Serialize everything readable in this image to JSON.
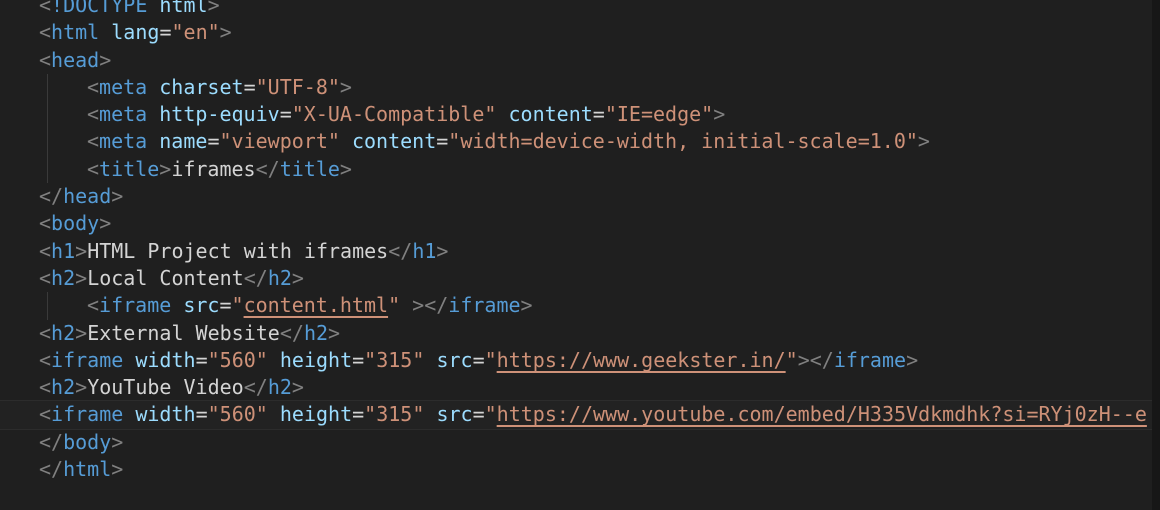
{
  "editor": {
    "lines": [
      {
        "indent": 0,
        "tokens": [
          [
            "br",
            "<"
          ],
          [
            "tg",
            "!DOCTYPE"
          ],
          [
            "tx",
            " "
          ],
          [
            "at",
            "html"
          ],
          [
            "br",
            ">"
          ]
        ]
      },
      {
        "indent": 0,
        "tokens": [
          [
            "br",
            "<"
          ],
          [
            "tg",
            "html"
          ],
          [
            "tx",
            " "
          ],
          [
            "at",
            "lang"
          ],
          [
            "eq",
            "="
          ],
          [
            "st",
            "\"en\""
          ],
          [
            "br",
            ">"
          ]
        ]
      },
      {
        "indent": 0,
        "tokens": [
          [
            "br",
            "<"
          ],
          [
            "tg",
            "head"
          ],
          [
            "br",
            ">"
          ]
        ]
      },
      {
        "indent": 1,
        "tokens": [
          [
            "br",
            "<"
          ],
          [
            "tg",
            "meta"
          ],
          [
            "tx",
            " "
          ],
          [
            "at",
            "charset"
          ],
          [
            "eq",
            "="
          ],
          [
            "st",
            "\"UTF-8\""
          ],
          [
            "br",
            ">"
          ]
        ]
      },
      {
        "indent": 1,
        "tokens": [
          [
            "br",
            "<"
          ],
          [
            "tg",
            "meta"
          ],
          [
            "tx",
            " "
          ],
          [
            "at",
            "http-equiv"
          ],
          [
            "eq",
            "="
          ],
          [
            "st",
            "\"X-UA-Compatible\""
          ],
          [
            "tx",
            " "
          ],
          [
            "at",
            "content"
          ],
          [
            "eq",
            "="
          ],
          [
            "st",
            "\"IE=edge\""
          ],
          [
            "br",
            ">"
          ]
        ]
      },
      {
        "indent": 1,
        "tokens": [
          [
            "br",
            "<"
          ],
          [
            "tg",
            "meta"
          ],
          [
            "tx",
            " "
          ],
          [
            "at",
            "name"
          ],
          [
            "eq",
            "="
          ],
          [
            "st",
            "\"viewport\""
          ],
          [
            "tx",
            " "
          ],
          [
            "at",
            "content"
          ],
          [
            "eq",
            "="
          ],
          [
            "st",
            "\"width=device-width, initial-scale=1.0\""
          ],
          [
            "br",
            ">"
          ]
        ]
      },
      {
        "indent": 1,
        "tokens": [
          [
            "br",
            "<"
          ],
          [
            "tg",
            "title"
          ],
          [
            "br",
            ">"
          ],
          [
            "tx",
            "iframes"
          ],
          [
            "br",
            "</"
          ],
          [
            "tg",
            "title"
          ],
          [
            "br",
            ">"
          ]
        ]
      },
      {
        "indent": 0,
        "tokens": [
          [
            "br",
            "</"
          ],
          [
            "tg",
            "head"
          ],
          [
            "br",
            ">"
          ]
        ]
      },
      {
        "indent": 0,
        "tokens": [
          [
            "br",
            "<"
          ],
          [
            "tg",
            "body"
          ],
          [
            "br",
            ">"
          ]
        ]
      },
      {
        "indent": 0,
        "tokens": [
          [
            "br",
            "<"
          ],
          [
            "tg",
            "h1"
          ],
          [
            "br",
            ">"
          ],
          [
            "tx",
            "HTML Project with iframes"
          ],
          [
            "br",
            "</"
          ],
          [
            "tg",
            "h1"
          ],
          [
            "br",
            ">"
          ]
        ]
      },
      {
        "indent": 0,
        "tokens": [
          [
            "br",
            "<"
          ],
          [
            "tg",
            "h2"
          ],
          [
            "br",
            ">"
          ],
          [
            "tx",
            "Local Content"
          ],
          [
            "br",
            "</"
          ],
          [
            "tg",
            "h2"
          ],
          [
            "br",
            ">"
          ]
        ]
      },
      {
        "indent": 1,
        "tokens": [
          [
            "br",
            "<"
          ],
          [
            "tg",
            "iframe"
          ],
          [
            "tx",
            " "
          ],
          [
            "at",
            "src"
          ],
          [
            "eq",
            "="
          ],
          [
            "st",
            "\""
          ],
          [
            "lk",
            "content.html"
          ],
          [
            "st",
            "\""
          ],
          [
            "tx",
            " "
          ],
          [
            "br",
            "></"
          ],
          [
            "tg",
            "iframe"
          ],
          [
            "br",
            ">"
          ]
        ]
      },
      {
        "indent": 0,
        "tokens": [
          [
            "br",
            "<"
          ],
          [
            "tg",
            "h2"
          ],
          [
            "br",
            ">"
          ],
          [
            "tx",
            "External Website"
          ],
          [
            "br",
            "</"
          ],
          [
            "tg",
            "h2"
          ],
          [
            "br",
            ">"
          ]
        ]
      },
      {
        "indent": 0,
        "tokens": [
          [
            "br",
            "<"
          ],
          [
            "tg",
            "iframe"
          ],
          [
            "tx",
            " "
          ],
          [
            "at",
            "width"
          ],
          [
            "eq",
            "="
          ],
          [
            "st",
            "\"560\""
          ],
          [
            "tx",
            " "
          ],
          [
            "at",
            "height"
          ],
          [
            "eq",
            "="
          ],
          [
            "st",
            "\"315\""
          ],
          [
            "tx",
            " "
          ],
          [
            "at",
            "src"
          ],
          [
            "eq",
            "="
          ],
          [
            "st",
            "\""
          ],
          [
            "lk",
            "https://www.geekster.in/"
          ],
          [
            "st",
            "\""
          ],
          [
            "br",
            "></"
          ],
          [
            "tg",
            "iframe"
          ],
          [
            "br",
            ">"
          ]
        ]
      },
      {
        "indent": 0,
        "tokens": [
          [
            "br",
            "<"
          ],
          [
            "tg",
            "h2"
          ],
          [
            "br",
            ">"
          ],
          [
            "tx",
            "YouTube Video"
          ],
          [
            "br",
            "</"
          ],
          [
            "tg",
            "h2"
          ],
          [
            "br",
            ">"
          ]
        ]
      },
      {
        "indent": 0,
        "current": true,
        "tokens": [
          [
            "br",
            "<"
          ],
          [
            "tg",
            "iframe"
          ],
          [
            "tx",
            " "
          ],
          [
            "at",
            "width"
          ],
          [
            "eq",
            "="
          ],
          [
            "st",
            "\"560\""
          ],
          [
            "tx",
            " "
          ],
          [
            "at",
            "height"
          ],
          [
            "eq",
            "="
          ],
          [
            "st",
            "\"315\""
          ],
          [
            "tx",
            " "
          ],
          [
            "at",
            "src"
          ],
          [
            "eq",
            "="
          ],
          [
            "st",
            "\""
          ],
          [
            "lk",
            "https://www.youtube.com/embed/H335Vdkmdhk?si=RYj0zH--e"
          ]
        ]
      },
      {
        "indent": 0,
        "tokens": [
          [
            "br",
            "</"
          ],
          [
            "tg",
            "body"
          ],
          [
            "br",
            ">"
          ]
        ]
      },
      {
        "indent": 0,
        "tokens": [
          [
            "br",
            "</"
          ],
          [
            "tg",
            "html"
          ],
          [
            "br",
            ">"
          ]
        ]
      }
    ]
  }
}
